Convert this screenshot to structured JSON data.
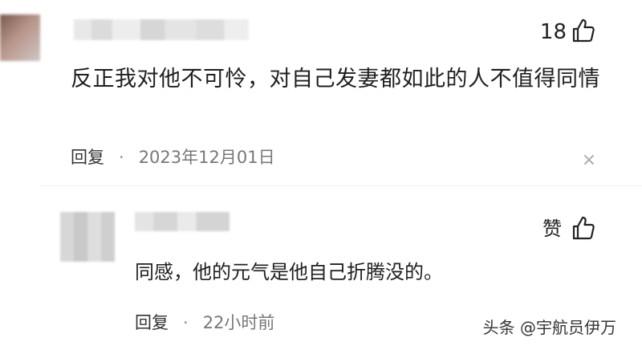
{
  "comment": {
    "like_count": "18",
    "text": "反正我对他不可怜，对自己发妻都如此的人不值得同情",
    "reply_label": "回复",
    "separator": "·",
    "timestamp": "2023年12月01日",
    "close_symbol": "×"
  },
  "reply": {
    "like_label": "赞",
    "text": "同感，他的元气是他自己折腾没的。",
    "reply_label": "回复",
    "separator": "·",
    "timestamp": "22小时前"
  },
  "watermark": "头条 @宇航员伊万",
  "icons": {
    "like": "thumbs-up-icon",
    "close": "close-icon"
  }
}
